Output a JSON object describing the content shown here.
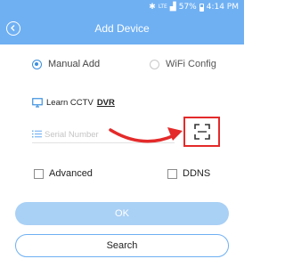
{
  "status_bar": {
    "bluetooth_icon": "bluetooth-icon",
    "network_label": "LTE",
    "battery_percent": "57%",
    "time": "4:14 PM"
  },
  "header": {
    "title": "Add Device",
    "back_icon": "chevron-left-icon"
  },
  "add_mode": {
    "options": [
      {
        "label": "Manual Add",
        "selected": true
      },
      {
        "label": "WiFi Config",
        "selected": false
      }
    ]
  },
  "learn_link": {
    "prefix": "Learn CCTV",
    "highlight": "DVR",
    "icon": "monitor-icon"
  },
  "serial": {
    "placeholder": "Serial Number",
    "value": "",
    "scan_icon": "qr-scan-icon"
  },
  "options": {
    "advanced_label": "Advanced",
    "ddns_label": "DDNS"
  },
  "buttons": {
    "ok_label": "OK",
    "search_label": "Search"
  },
  "colors": {
    "header_bg": "#6fb0f3",
    "accent": "#3a8fe0",
    "ok_button": "#a9d0f5",
    "annotation_red": "#e42a2a"
  }
}
